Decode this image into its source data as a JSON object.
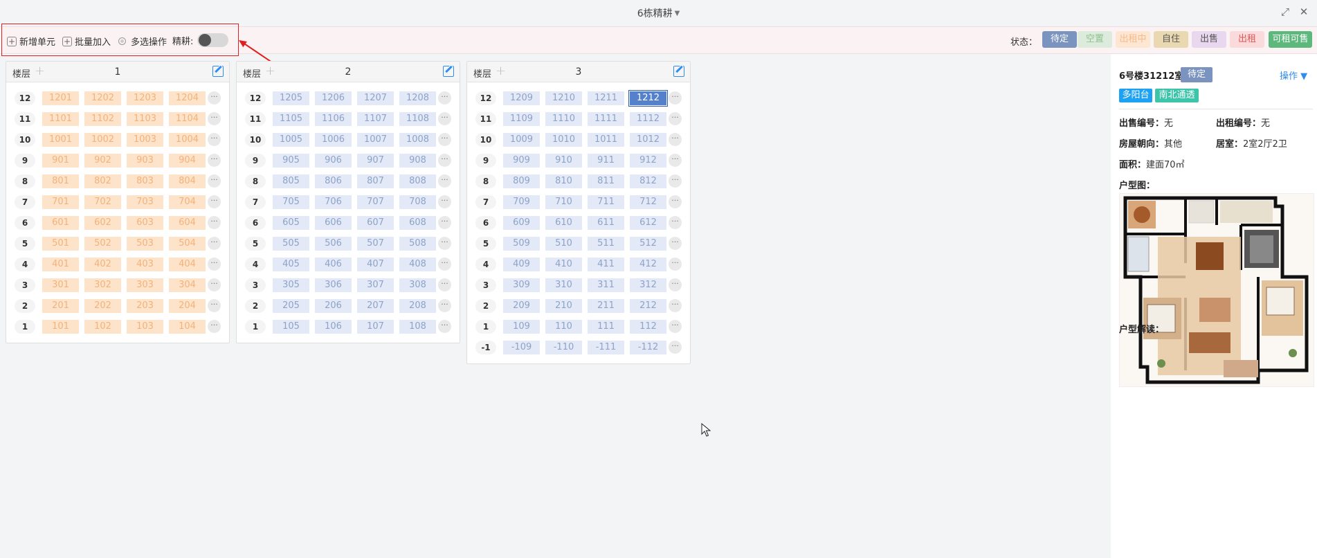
{
  "window": {
    "title": "6栋精耕"
  },
  "toolbar": {
    "add_unit": "新增单元",
    "batch_add": "批量加入",
    "multi_select": "多选操作",
    "fine_label": "精耕:",
    "status_label": "状态："
  },
  "statuses": [
    {
      "label": "待定",
      "bg": "#7b93bf",
      "fg": "#ffffff"
    },
    {
      "label": "空置",
      "bg": "#dcebdc",
      "fg": "#8fc08f"
    },
    {
      "label": "出租中",
      "bg": "#fde6d2",
      "fg": "#f7b98a"
    },
    {
      "label": "自住",
      "bg": "#ead9b0",
      "fg": "#555555"
    },
    {
      "label": "出售",
      "bg": "#e9d7ef",
      "fg": "#555555"
    },
    {
      "label": "出租",
      "bg": "#fadada",
      "fg": "#e05555"
    },
    {
      "label": "可租可售",
      "bg": "#5cb97b",
      "fg": "#ffffff"
    }
  ],
  "units": [
    {
      "floor_header": "楼层",
      "name": "1",
      "style": "orange",
      "floors": [
        {
          "floor": "12",
          "rooms": [
            "1201",
            "1202",
            "1203",
            "1204"
          ]
        },
        {
          "floor": "11",
          "rooms": [
            "1101",
            "1102",
            "1103",
            "1104"
          ]
        },
        {
          "floor": "10",
          "rooms": [
            "1001",
            "1002",
            "1003",
            "1004"
          ]
        },
        {
          "floor": "9",
          "rooms": [
            "901",
            "902",
            "903",
            "904"
          ]
        },
        {
          "floor": "8",
          "rooms": [
            "801",
            "802",
            "803",
            "804"
          ]
        },
        {
          "floor": "7",
          "rooms": [
            "701",
            "702",
            "703",
            "704"
          ]
        },
        {
          "floor": "6",
          "rooms": [
            "601",
            "602",
            "603",
            "604"
          ]
        },
        {
          "floor": "5",
          "rooms": [
            "501",
            "502",
            "503",
            "504"
          ]
        },
        {
          "floor": "4",
          "rooms": [
            "401",
            "402",
            "403",
            "404"
          ]
        },
        {
          "floor": "3",
          "rooms": [
            "301",
            "302",
            "303",
            "304"
          ]
        },
        {
          "floor": "2",
          "rooms": [
            "201",
            "202",
            "203",
            "204"
          ]
        },
        {
          "floor": "1",
          "rooms": [
            "101",
            "102",
            "103",
            "104"
          ]
        }
      ]
    },
    {
      "floor_header": "楼层",
      "name": "2",
      "style": "blue",
      "floors": [
        {
          "floor": "12",
          "rooms": [
            "1205",
            "1206",
            "1207",
            "1208"
          ]
        },
        {
          "floor": "11",
          "rooms": [
            "1105",
            "1106",
            "1107",
            "1108"
          ]
        },
        {
          "floor": "10",
          "rooms": [
            "1005",
            "1006",
            "1007",
            "1008"
          ]
        },
        {
          "floor": "9",
          "rooms": [
            "905",
            "906",
            "907",
            "908"
          ]
        },
        {
          "floor": "8",
          "rooms": [
            "805",
            "806",
            "807",
            "808"
          ]
        },
        {
          "floor": "7",
          "rooms": [
            "705",
            "706",
            "707",
            "708"
          ]
        },
        {
          "floor": "6",
          "rooms": [
            "605",
            "606",
            "607",
            "608"
          ]
        },
        {
          "floor": "5",
          "rooms": [
            "505",
            "506",
            "507",
            "508"
          ]
        },
        {
          "floor": "4",
          "rooms": [
            "405",
            "406",
            "407",
            "408"
          ]
        },
        {
          "floor": "3",
          "rooms": [
            "305",
            "306",
            "307",
            "308"
          ]
        },
        {
          "floor": "2",
          "rooms": [
            "205",
            "206",
            "207",
            "208"
          ]
        },
        {
          "floor": "1",
          "rooms": [
            "105",
            "106",
            "107",
            "108"
          ]
        }
      ]
    },
    {
      "floor_header": "楼层",
      "name": "3",
      "style": "blue",
      "selected_room": "1212",
      "floors": [
        {
          "floor": "12",
          "rooms": [
            "1209",
            "1210",
            "1211",
            "1212"
          ]
        },
        {
          "floor": "11",
          "rooms": [
            "1109",
            "1110",
            "1111",
            "1112"
          ]
        },
        {
          "floor": "10",
          "rooms": [
            "1009",
            "1010",
            "1011",
            "1012"
          ]
        },
        {
          "floor": "9",
          "rooms": [
            "909",
            "910",
            "911",
            "912"
          ]
        },
        {
          "floor": "8",
          "rooms": [
            "809",
            "810",
            "811",
            "812"
          ]
        },
        {
          "floor": "7",
          "rooms": [
            "709",
            "710",
            "711",
            "712"
          ]
        },
        {
          "floor": "6",
          "rooms": [
            "609",
            "610",
            "611",
            "612"
          ]
        },
        {
          "floor": "5",
          "rooms": [
            "509",
            "510",
            "511",
            "512"
          ]
        },
        {
          "floor": "4",
          "rooms": [
            "409",
            "410",
            "411",
            "412"
          ]
        },
        {
          "floor": "3",
          "rooms": [
            "309",
            "310",
            "311",
            "312"
          ]
        },
        {
          "floor": "2",
          "rooms": [
            "209",
            "210",
            "211",
            "212"
          ]
        },
        {
          "floor": "1",
          "rooms": [
            "109",
            "110",
            "111",
            "112"
          ]
        },
        {
          "floor": "-1",
          "rooms": [
            "-109",
            "-110",
            "-111",
            "-112"
          ]
        }
      ]
    }
  ],
  "detail": {
    "title": "6号楼31212室",
    "status": "待定",
    "ops": "操作 ▼",
    "tags": [
      {
        "label": "多阳台",
        "bg": "#1da1f2"
      },
      {
        "label": "南北通透",
        "bg": "#3cc5a8"
      }
    ],
    "sale_no_label": "出售编号：",
    "sale_no": "无",
    "rent_no_label": "出租编号：",
    "rent_no": "无",
    "orientation_label": "房屋朝向：",
    "orientation": "其他",
    "layout_label": "居室：",
    "layout": "2室2厅2卫",
    "area_label": "面积：",
    "area": "建面70㎡",
    "floorplan_label": "户型图：",
    "interpretation_label": "户型解读："
  }
}
